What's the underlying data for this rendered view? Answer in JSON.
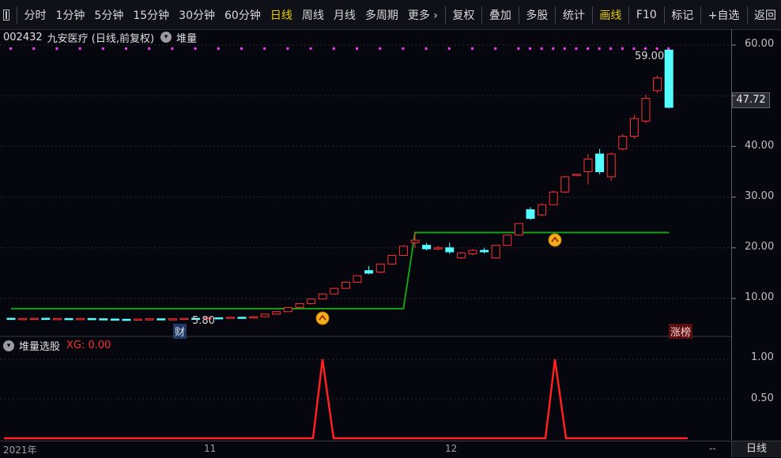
{
  "toolbar": {
    "items": [
      "分时",
      "1分钟",
      "5分钟",
      "15分钟",
      "30分钟",
      "60分钟",
      "日线",
      "周线",
      "月线",
      "多周期",
      "更多 ›"
    ],
    "active": "日线",
    "tools": [
      "复权",
      "叠加",
      "多股",
      "统计",
      "画线",
      "F10",
      "标记",
      "+自选",
      "返回"
    ],
    "active_tool": "画线"
  },
  "chart_title": {
    "code": "002432",
    "name": "九安医疗 (日线,前复权)",
    "indicator": "堆量"
  },
  "sub_title": {
    "name": "堆量选股",
    "xg_label": "XG: 0.00"
  },
  "price_axis": [
    "60.00",
    "50.00",
    "40.00",
    "30.00",
    "20.00",
    "10.00"
  ],
  "current_price": "47.72",
  "sub_axis": [
    "1.00",
    "0.50"
  ],
  "annotations": {
    "high": "59.00",
    "low": "5.80",
    "fin_tag": "财",
    "limit_tag": "涨榜"
  },
  "date_axis": {
    "start": "2021年",
    "m11": "11",
    "m12": "12",
    "period": "日线",
    "dash": "--"
  },
  "colors": {
    "up": "#ff3030",
    "down": "#54ffff",
    "ma": "#16a016",
    "signal": "#ff2020",
    "dots": "#ff30ff"
  },
  "chart_data": [
    {
      "type": "candlestick",
      "ylim": [
        0,
        62
      ],
      "candles": [
        [
          6.1,
          6.0,
          6.2,
          5.9
        ],
        [
          6.0,
          6.05,
          6.1,
          5.95
        ],
        [
          6.05,
          6.1,
          6.2,
          6.0
        ],
        [
          6.1,
          6.0,
          6.15,
          5.95
        ],
        [
          6.0,
          6.05,
          6.1,
          5.9
        ],
        [
          6.05,
          6.0,
          6.1,
          5.95
        ],
        [
          6.0,
          6.05,
          6.1,
          5.95
        ],
        [
          6.05,
          6.0,
          6.1,
          5.9
        ],
        [
          6.0,
          5.95,
          6.05,
          5.9
        ],
        [
          5.95,
          5.9,
          6.0,
          5.85
        ],
        [
          5.9,
          5.85,
          5.95,
          5.8
        ],
        [
          5.85,
          5.95,
          6.0,
          5.8
        ],
        [
          5.95,
          6.0,
          6.05,
          5.9
        ],
        [
          6.0,
          5.9,
          6.05,
          5.85
        ],
        [
          5.9,
          6.0,
          6.05,
          5.85
        ],
        [
          6.0,
          6.1,
          6.15,
          5.95
        ],
        [
          6.1,
          6.05,
          6.15,
          6.0
        ],
        [
          6.05,
          6.2,
          6.25,
          6.0
        ],
        [
          6.2,
          6.15,
          6.3,
          6.1
        ],
        [
          6.15,
          6.3,
          6.35,
          6.1
        ],
        [
          6.3,
          6.25,
          6.4,
          6.2
        ],
        [
          6.25,
          6.4,
          6.5,
          6.2
        ],
        [
          6.4,
          6.9,
          7.0,
          6.3
        ],
        [
          6.9,
          7.4,
          7.5,
          6.8
        ],
        [
          7.4,
          8.2,
          8.3,
          7.4
        ],
        [
          8.2,
          9.0,
          9.1,
          8.2
        ],
        [
          9.0,
          9.9,
          10.0,
          9.0
        ],
        [
          9.9,
          10.9,
          11.0,
          9.9
        ],
        [
          10.9,
          12.0,
          12.1,
          10.9
        ],
        [
          12.0,
          13.2,
          13.3,
          12.0
        ],
        [
          13.2,
          14.5,
          14.6,
          13.2
        ],
        [
          15.5,
          15.0,
          16.4,
          14.8
        ],
        [
          15.2,
          16.8,
          16.9,
          15.0
        ],
        [
          16.8,
          18.5,
          18.6,
          16.8
        ],
        [
          18.5,
          20.3,
          20.5,
          18.5
        ],
        [
          21.0,
          21.5,
          23.0,
          20.0
        ],
        [
          20.5,
          19.8,
          21.0,
          19.5
        ],
        [
          19.8,
          20.0,
          20.4,
          19.5
        ],
        [
          20.0,
          19.2,
          21.0,
          18.8
        ],
        [
          18.0,
          19.0,
          19.2,
          17.8
        ],
        [
          18.8,
          19.5,
          19.8,
          18.5
        ],
        [
          19.5,
          19.2,
          20.0,
          18.9
        ],
        [
          18.0,
          20.5,
          20.6,
          17.9
        ],
        [
          20.5,
          22.5,
          22.6,
          20.4
        ],
        [
          22.5,
          24.8,
          24.9,
          22.4
        ],
        [
          27.5,
          25.8,
          28.0,
          25.5
        ],
        [
          26.5,
          28.5,
          28.8,
          26.2
        ],
        [
          28.5,
          31.0,
          31.3,
          28.4
        ],
        [
          31.0,
          34.0,
          34.2,
          30.8
        ],
        [
          34.5,
          34.5,
          34.6,
          34.4
        ],
        [
          35.0,
          37.5,
          38.5,
          32.5
        ],
        [
          38.5,
          35.0,
          39.5,
          34.5
        ],
        [
          34.0,
          38.5,
          38.8,
          33.2
        ],
        [
          39.5,
          42.0,
          42.5,
          39.2
        ],
        [
          42.0,
          45.5,
          46.2,
          41.5
        ],
        [
          45.0,
          49.5,
          50.2,
          44.5
        ],
        [
          51.0,
          53.5,
          54.0,
          50.5
        ],
        [
          59.0,
          47.7,
          59.0,
          47.5
        ]
      ],
      "ma_line": [
        8,
        8,
        8,
        8,
        8,
        8,
        8,
        8,
        8,
        8,
        8,
        8,
        8,
        8,
        8,
        8,
        8,
        8,
        8,
        8,
        8,
        8,
        8,
        8,
        8,
        8,
        8,
        8,
        8,
        8,
        8,
        8,
        8,
        8,
        8,
        23,
        23,
        23,
        23,
        23,
        23,
        23,
        23,
        23,
        23,
        23,
        23,
        23,
        23,
        23,
        23,
        23,
        23,
        23,
        23,
        23,
        23,
        23
      ]
    },
    {
      "type": "line",
      "name": "XG",
      "ylim": [
        0,
        1.2
      ],
      "values": [
        0,
        0,
        0,
        0,
        0,
        0,
        0,
        0,
        0,
        0,
        0,
        0,
        0,
        0,
        0,
        0,
        0,
        0,
        0,
        0,
        0,
        0,
        0,
        0,
        0,
        0,
        0,
        0,
        0,
        0,
        0,
        0,
        0,
        0,
        0,
        0,
        0,
        0,
        0,
        0,
        0,
        0,
        0,
        0,
        0,
        0,
        0,
        0,
        0,
        0,
        0,
        0,
        0,
        0,
        0,
        0,
        0,
        0
      ],
      "peaks": [
        1,
        1
      ]
    }
  ]
}
